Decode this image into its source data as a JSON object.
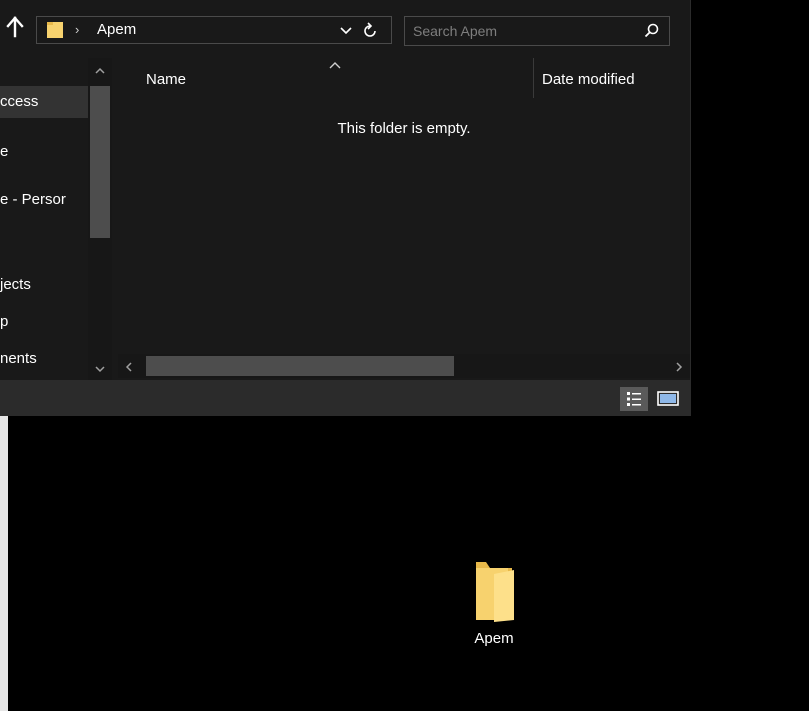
{
  "window": {
    "address": {
      "separator": "›",
      "path": "Apem"
    },
    "search": {
      "placeholder": "Search Apem"
    },
    "nav_pane": {
      "items": [
        {
          "label": "ccess",
          "selected": true
        },
        {
          "label": "e",
          "selected": false
        },
        {
          "label": "e - Persor",
          "selected": false
        },
        {
          "label": "jects",
          "selected": false
        },
        {
          "label": "p",
          "selected": false
        },
        {
          "label": "nents",
          "selected": false
        }
      ]
    },
    "content": {
      "columns": [
        {
          "label": "Name"
        },
        {
          "label": "Date modified"
        }
      ],
      "empty_message": "This folder is empty."
    }
  },
  "desktop": {
    "icons": [
      {
        "label": "Apem",
        "icon": "folder-icon"
      }
    ]
  },
  "colors": {
    "window_bg": "#191919",
    "status_bar_bg": "#2b2b2b",
    "scroll_thumb": "#4d4d4d",
    "selected_nav": "#333333",
    "folder_yellow": "#f7d26e",
    "desktop_bg": "#000000"
  }
}
